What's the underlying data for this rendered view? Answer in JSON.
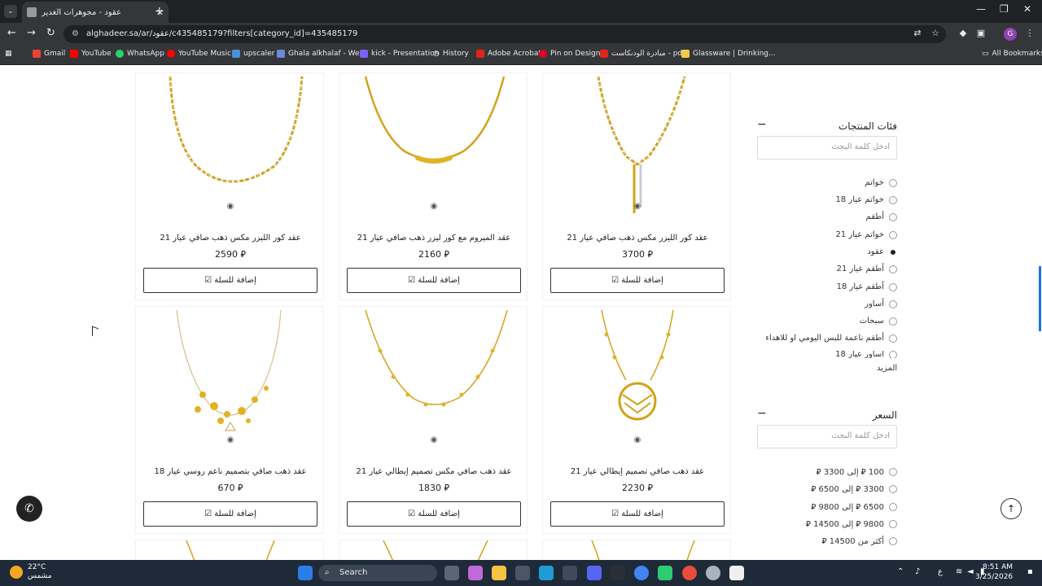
{
  "browser": {
    "tab_title": "عقود - مجوهرات الغدير",
    "url": "alghadeer.sa/ar/عقود/c435485179?filters[category_id]=435485179",
    "bookmarks": [
      "Gmail",
      "YouTube",
      "WhatsApp",
      "YouTube Music",
      "upscaler",
      "Ghala alkhalaf - We...",
      "kick - Presentation",
      "History",
      "Adobe Acrobat",
      "Pin on Design",
      "مبادرة الودنكاست - pdf",
      "Glassware | Drinking...",
      "All Bookmarks"
    ]
  },
  "products": [
    {
      "name": "عقد كور الليزر مكس ذهب صافي عيار 21",
      "price": "2590 ⃁",
      "button": "إضافة للسلة"
    },
    {
      "name": "عقد الميروم مع كور ليزر ذهب صافي عيار 21",
      "price": "2160 ⃁",
      "button": "إضافة للسلة"
    },
    {
      "name": "عقد كور الليزر مكس ذهب صافي عيار 21",
      "price": "3700 ⃁",
      "button": "إضافة للسلة"
    },
    {
      "name": "عقد ذهب صافي بتصميم ناعم روسي عيار 18",
      "price": "670 ⃁",
      "button": "إضافة للسلة"
    },
    {
      "name": "عقد ذهب صافي مكس تصميم إيطالي عيار 21",
      "price": "1830 ⃁",
      "button": "إضافة للسلة"
    },
    {
      "name": "عقد ذهب صافي تصميم إيطالي عيار 21",
      "price": "2230 ⃁",
      "button": "إضافة للسلة"
    }
  ],
  "filters": {
    "categories_title": "فئات المنتجات",
    "categories_search_placeholder": "ادخل كلمة البحث",
    "categories": [
      {
        "label": "خواتم",
        "selected": false
      },
      {
        "label": "خواتم عيار 18",
        "selected": false
      },
      {
        "label": "أطقم",
        "selected": false
      },
      {
        "label": "خواتم عيار 21",
        "selected": false
      },
      {
        "label": "عقود",
        "selected": true
      },
      {
        "label": "أطقم عيار 21",
        "selected": false
      },
      {
        "label": "أطقم عيار 18",
        "selected": false
      },
      {
        "label": "أساور",
        "selected": false
      },
      {
        "label": "سبحات",
        "selected": false
      },
      {
        "label": "أطقم ناعمة للبس اليومي او للاهداء",
        "selected": false
      },
      {
        "label": "أساور عيار 18",
        "selected": false
      }
    ],
    "more_label": "المزيد",
    "price_title": "السعر",
    "price_search_placeholder": "ادخل كلمة البحث",
    "price_ranges": [
      "100 ⃁ إلى 3300 ⃁",
      "3300 ⃁ إلى 6500 ⃁",
      "6500 ⃁ إلى 9800 ⃁",
      "9800 ⃁ إلى 14500 ⃁",
      "أكثر من 14500 ⃁"
    ]
  },
  "taskbar": {
    "temperature": "22°C",
    "weather": "مشمس",
    "search_label": "Search",
    "time": "8:51 AM",
    "date": "3/25/2026",
    "lang": "ع"
  }
}
